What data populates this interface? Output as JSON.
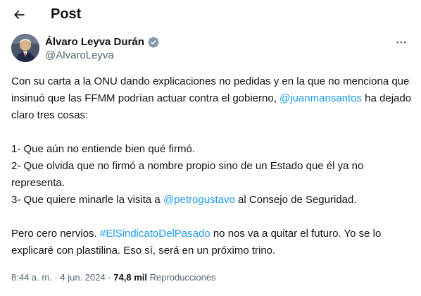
{
  "header": {
    "title": "Post"
  },
  "author": {
    "display_name": "Álvaro Leyva Durán",
    "handle": "@AlvaroLeyva",
    "verified_color": "#829aab"
  },
  "tweet": {
    "p1_a": "Con su carta a la ONU dando explicaciones no pedidas y en la que no menciona que insinuó que las FFMM podrían actuar contra el gobierno, ",
    "p1_mention": "@juanmansantos",
    "p1_b": " ha dejado claro tres cosas:",
    "item1": "1- Que aún no entiende bien qué firmó.",
    "item2": "2- Que olvida que no firmó a nombre propio sino de un Estado que él ya no representa.",
    "item3_a": "3- Que quiere minarle la visita a ",
    "item3_mention": "@petrogustavo",
    "item3_b": " al Consejo de Seguridad.",
    "p3_a": "Pero cero nervios. ",
    "p3_hashtag": "#ElSindicatoDelPasado",
    "p3_b": " no nos va a quitar el futuro. Yo se lo explicaré con plastilina. Eso sí, será en un próximo trino."
  },
  "meta": {
    "time": "8:44 a. m.",
    "separator": " · ",
    "date": "4 jun. 2024",
    "views_count": "74,8 mil",
    "views_label": "Reproducciones"
  },
  "colors": {
    "link": "#1d9bf0",
    "text": "#0f1419",
    "secondary": "#536471"
  }
}
